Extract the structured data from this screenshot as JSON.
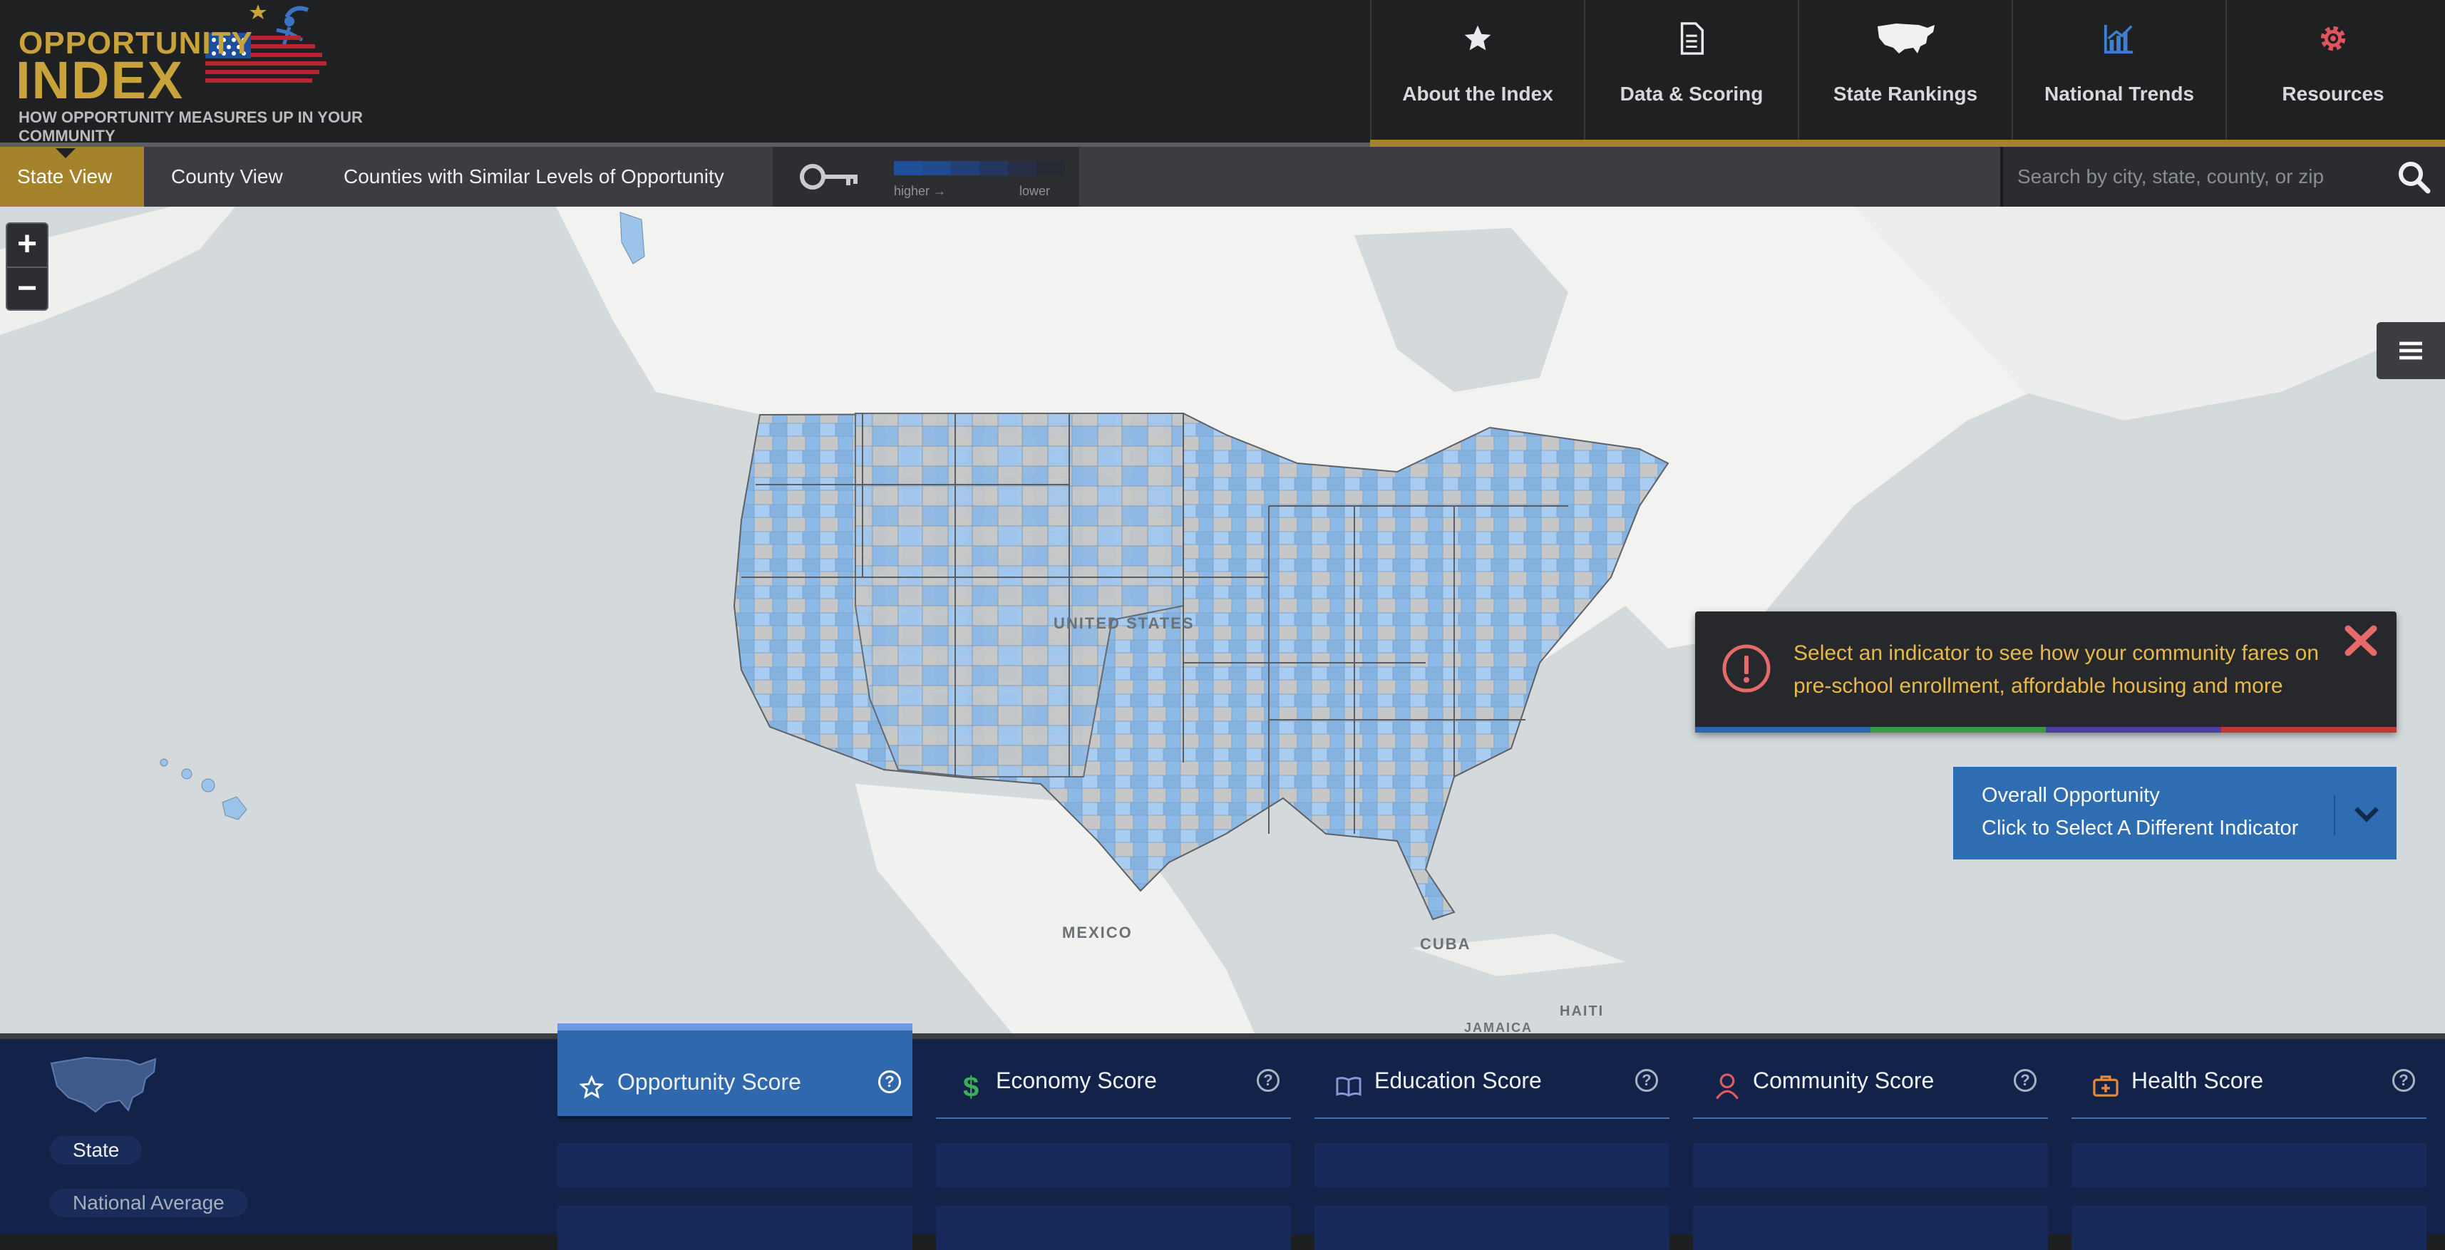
{
  "header": {
    "logo": {
      "line1": "OPPORTUNITY",
      "line2": "INDEX",
      "tagline": "HOW OPPORTUNITY MEASURES UP IN YOUR COMMUNITY"
    },
    "nav": [
      {
        "label": "About the Index",
        "icon": "star-icon"
      },
      {
        "label": "Data & Scoring",
        "icon": "document-icon"
      },
      {
        "label": "State Rankings",
        "icon": "us-map-icon"
      },
      {
        "label": "National Trends",
        "icon": "chart-icon"
      },
      {
        "label": "Resources",
        "icon": "gear-icon"
      }
    ],
    "accent_color": "#a4832c"
  },
  "toolbar": {
    "tabs": [
      "State View",
      "County View",
      "Counties with Similar Levels of Opportunity"
    ],
    "active_tab": "State View",
    "legend": {
      "higher_label": "higher →",
      "lower_label": "lower",
      "colors": [
        "#1f4f9a",
        "#214a8c",
        "#233f76",
        "#24375f",
        "#262f47",
        "#272a33"
      ]
    },
    "search": {
      "placeholder": "Search by city, state, county, or zip",
      "value": ""
    }
  },
  "map": {
    "labels": [
      "UNITED STATES",
      "MEXICO",
      "CUBA",
      "HAITI",
      "JAMAICA"
    ],
    "zoom_in": "+",
    "zoom_out": "−"
  },
  "notice": {
    "message": "Select an indicator to see how your community fares on pre-school enrollment, affordable housing and more",
    "stripe_colors": [
      "#2e64b0",
      "#3b9a4a",
      "#4d3f9e",
      "#c0383a"
    ]
  },
  "indicator": {
    "title": "Overall Opportunity",
    "subtitle": "Click to Select A Different Indicator"
  },
  "bottom": {
    "pills": {
      "state": "State",
      "national": "National Average"
    },
    "score_tabs": [
      {
        "label": "Opportunity Score",
        "icon": "star-outline-icon",
        "active": true
      },
      {
        "label": "Economy Score",
        "icon": "dollar-icon",
        "active": false
      },
      {
        "label": "Education Score",
        "icon": "book-icon",
        "active": false
      },
      {
        "label": "Community Score",
        "icon": "person-icon",
        "active": false
      },
      {
        "label": "Health Score",
        "icon": "medical-kit-icon",
        "active": false
      }
    ],
    "help_glyph": "?"
  }
}
